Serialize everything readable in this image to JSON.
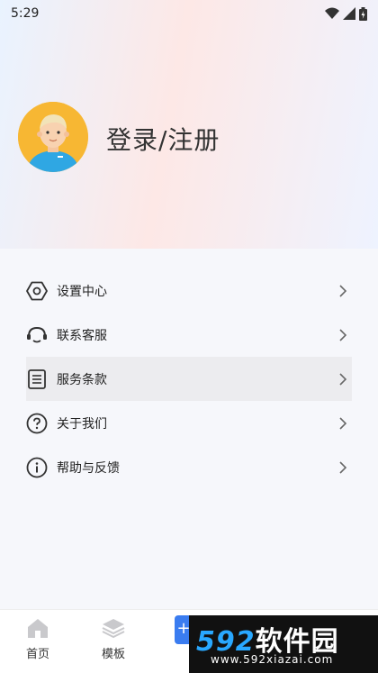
{
  "status": {
    "time": "5:29"
  },
  "header": {
    "login_title": "登录/注册"
  },
  "menu": [
    {
      "label": "设置中心",
      "icon": "settings-hex-icon"
    },
    {
      "label": "联系客服",
      "icon": "headset-icon"
    },
    {
      "label": "服务条款",
      "icon": "document-icon",
      "active": true
    },
    {
      "label": "关于我们",
      "icon": "question-circle-icon"
    },
    {
      "label": "帮助与反馈",
      "icon": "info-circle-icon"
    }
  ],
  "tabs": [
    {
      "label": "首页",
      "icon": "home-icon"
    },
    {
      "label": "模板",
      "icon": "layers-icon"
    }
  ],
  "fab": {
    "label": "+"
  },
  "watermark": {
    "main_number": "592",
    "main_text": "软件园",
    "url": "www.592xiazai.com"
  },
  "colors": {
    "accent": "#3a7cf0",
    "watermark_blue": "#29a8ff"
  }
}
